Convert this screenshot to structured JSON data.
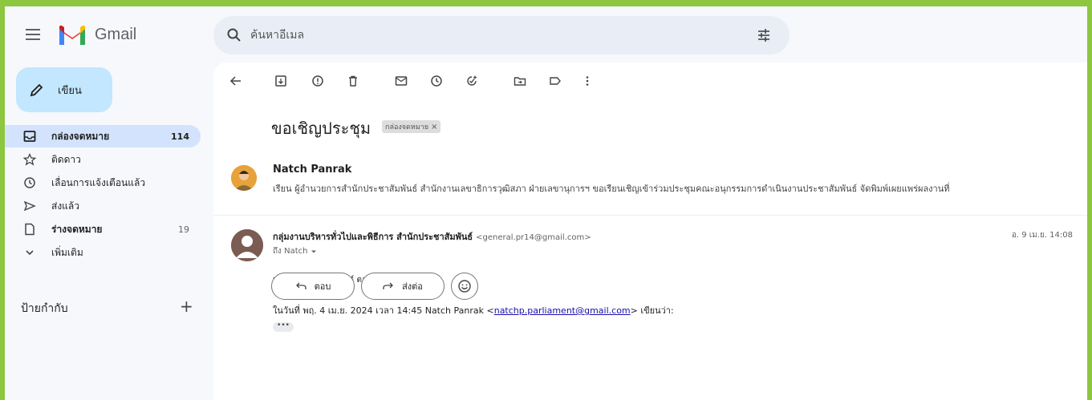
{
  "app": {
    "name": "Gmail"
  },
  "search": {
    "placeholder": "ค้นหาอีเมล"
  },
  "compose": {
    "label": "เขียน"
  },
  "nav": {
    "items": [
      {
        "label": "กล่องจดหมาย",
        "count": "114"
      },
      {
        "label": "ติดดาว",
        "count": ""
      },
      {
        "label": "เลื่อนการแจ้งเตือนแล้ว",
        "count": ""
      },
      {
        "label": "ส่งแล้ว",
        "count": ""
      },
      {
        "label": "ร่างจดหมาย",
        "count": "19"
      },
      {
        "label": "เพิ่มเติม",
        "count": ""
      }
    ],
    "labels_heading": "ป้ายกำกับ",
    "labels_add": "+"
  },
  "thread": {
    "subject": "ขอเชิญประชุม",
    "label_chip": "กล่องจดหมาย",
    "label_chip_close": "×",
    "messages": [
      {
        "sender": "Natch Panrak",
        "snippet": "เรียน ผู้อำนวยการสำนักประชาสัมพันธ์ สำนักงานเลขาธิการวุฒิสภา ฝ่ายเลขานุการฯ ขอเรียนเชิญเข้าร่วมประชุมคณะอนุกรรมการดำเนินงานประชาสัมพันธ์ จัดพิมพ์เผยแพร่ผลงานที่"
      },
      {
        "sender": "กลุ่มงานบริหารทั่วไปและพิธีการ สำนักประชาสัมพันธ์",
        "email": "<general.pr14@gmail.com>",
        "to": "ถึง Natch",
        "date": "อ. 9 เม.ย. 14:08",
        "body_line": "ผอ.สำนักประชาสัมพันธ์ ตอบรับเข้าร่วมประชุมค่ะ",
        "quote_prefix": "ในวันที่ พฤ. 4 เม.ย. 2024 เวลา 14:45 Natch Panrak <",
        "quote_link": "natchp.parliament@gmail.com",
        "quote_suffix": "> เขียนว่า:",
        "ellipsis": "•••"
      }
    ]
  },
  "actions": {
    "reply": "ตอบ",
    "forward": "ส่งต่อ"
  }
}
